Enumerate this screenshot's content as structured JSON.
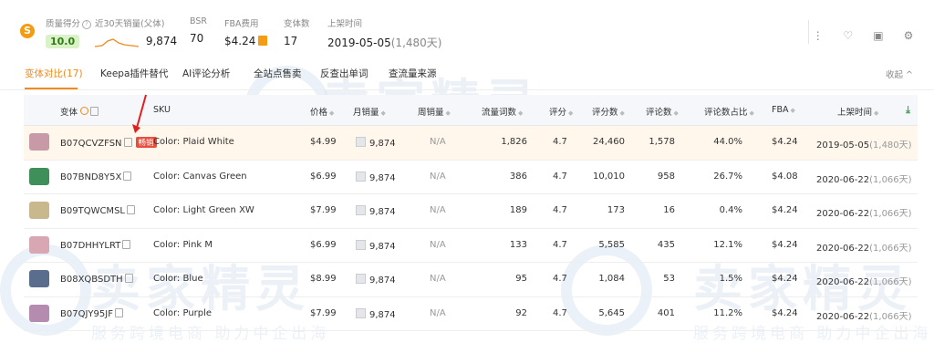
{
  "header": {
    "score": {
      "label": "质量得分",
      "value": "10.0"
    },
    "sales30": {
      "label": "近30天销量(父体)",
      "value": "9,874"
    },
    "bsr": {
      "label": "BSR",
      "value": "70"
    },
    "fba": {
      "label": "FBA费用",
      "value": "$4.24"
    },
    "variants": {
      "label": "变体数",
      "value": "17"
    },
    "listed": {
      "label": "上架时间",
      "date": "2019-05-05",
      "days": "(1,480天)"
    }
  },
  "tabs": [
    {
      "label": "变体对比(17)",
      "active": true
    },
    {
      "label": "Keepa插件替代"
    },
    {
      "label": "AI评论分析"
    },
    {
      "label": "全站点售卖"
    },
    {
      "label": "反查出单词"
    },
    {
      "label": "查流量来源"
    }
  ],
  "collapse_label": "收起 ^",
  "columns": {
    "variant": "变体",
    "sku": "SKU",
    "price": "价格",
    "monthly_sales": "月销量",
    "weekly_sales": "周销量",
    "traffic_words": "流量词数",
    "rating": "评分",
    "rating_score": "评分数",
    "reviews": "评论数",
    "review_share": "评论数占比",
    "fba": "FBA",
    "listed": "上架时间"
  },
  "hot_tag": "畅销",
  "rows": [
    {
      "asin": "B07QCVZFSN",
      "sku": "Color: Plaid White",
      "price": "$4.99",
      "monthly": "9,874",
      "weekly": "N/A",
      "traffic": "1,826",
      "rating": "4.7",
      "rating_score": "24,460",
      "reviews": "1,578",
      "share": "44.0%",
      "fba": "$4.24",
      "date": "2019-05-05",
      "days": "(1,480天)",
      "hot": true,
      "color": "#c89aa8"
    },
    {
      "asin": "B07BND8Y5X",
      "sku": "Color: Canvas Green",
      "price": "$6.99",
      "monthly": "9,874",
      "weekly": "N/A",
      "traffic": "386",
      "rating": "4.7",
      "rating_score": "10,010",
      "reviews": "958",
      "share": "26.7%",
      "fba": "$4.08",
      "date": "2020-06-22",
      "days": "(1,066天)",
      "color": "#3f8f5a"
    },
    {
      "asin": "B09TQWCMSL",
      "sku": "Color: Light Green XW",
      "price": "$7.99",
      "monthly": "9,874",
      "weekly": "N/A",
      "traffic": "189",
      "rating": "4.7",
      "rating_score": "173",
      "reviews": "16",
      "share": "0.4%",
      "fba": "$4.24",
      "date": "2020-06-22",
      "days": "(1,066天)",
      "color": "#c9b88e"
    },
    {
      "asin": "B07DHHYLRT",
      "sku": "Color: Pink M",
      "price": "$6.99",
      "monthly": "9,874",
      "weekly": "N/A",
      "traffic": "133",
      "rating": "4.7",
      "rating_score": "5,585",
      "reviews": "435",
      "share": "12.1%",
      "fba": "$4.24",
      "date": "2020-06-22",
      "days": "(1,066天)",
      "color": "#d9a7b4"
    },
    {
      "asin": "B08XQBSDTH",
      "sku": "Color: Blue",
      "price": "$8.99",
      "monthly": "9,874",
      "weekly": "N/A",
      "traffic": "95",
      "rating": "4.7",
      "rating_score": "1,084",
      "reviews": "53",
      "share": "1.5%",
      "fba": "$4.24",
      "date": "2020-06-22",
      "days": "(1,066天)",
      "color": "#5a6d8c"
    },
    {
      "asin": "B07QJY95JF",
      "sku": "Color: Purple",
      "price": "$7.99",
      "monthly": "9,874",
      "weekly": "N/A",
      "traffic": "92",
      "rating": "4.7",
      "rating_score": "5,645",
      "reviews": "401",
      "share": "11.2%",
      "fba": "$4.24",
      "date": "2020-06-22",
      "days": "(1,066天)",
      "color": "#b58bb0"
    }
  ],
  "watermark": {
    "big": "卖家精灵",
    "small": "服务跨境电商 助力中企出海"
  },
  "colors": {
    "accent": "#f0891e",
    "hot": "#e84d3d",
    "score_bg": "#d9f2c8",
    "download": "#2ea84a"
  }
}
